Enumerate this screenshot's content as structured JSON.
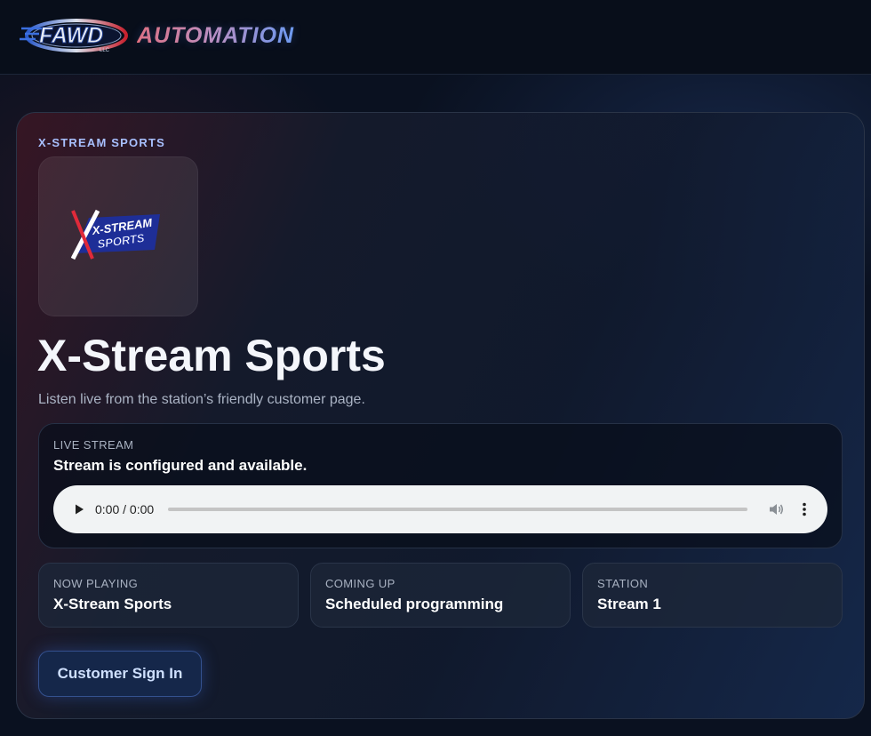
{
  "header": {
    "logo_text": "FAWD",
    "logo_subtext": "LLC",
    "brand_text": "AUTOMATION"
  },
  "station": {
    "eyebrow": "X-STREAM SPORTS",
    "logo_text_line1": "X-STREAM",
    "logo_text_line2": "SPORTS",
    "title": "X-Stream Sports",
    "subtitle": "Listen live from the station’s friendly customer page."
  },
  "live_stream": {
    "label": "LIVE STREAM",
    "status": "Stream is configured and available.",
    "player": {
      "time": "0:00 / 0:00",
      "progress": 0,
      "play_icon": "play-icon",
      "volume_icon": "volume-icon",
      "more_icon": "more-vertical-icon"
    }
  },
  "info_cards": [
    {
      "label": "NOW PLAYING",
      "value": "X-Stream Sports"
    },
    {
      "label": "COMING UP",
      "value": "Scheduled programming"
    },
    {
      "label": "STATION",
      "value": "Stream 1"
    }
  ],
  "actions": {
    "sign_in_label": "Customer Sign In"
  },
  "colors": {
    "background": "#0a1120",
    "accent": "#a8c0ff",
    "button_bg": "#15274a"
  }
}
